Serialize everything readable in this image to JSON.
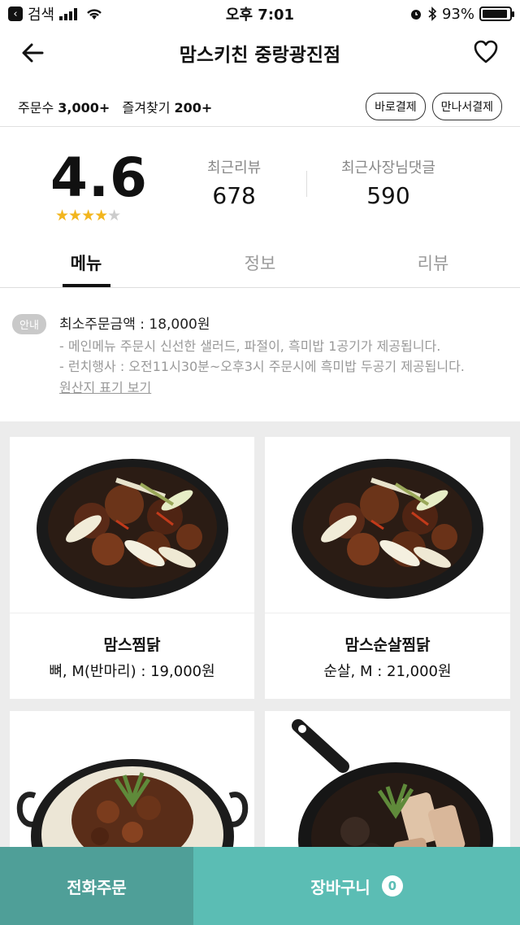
{
  "status_bar": {
    "back_app": "검색",
    "time": "오후 7:01",
    "battery_percent": "93%",
    "battery_level": 0.93
  },
  "header": {
    "title": "맘스키친 중랑광진점"
  },
  "order_info": {
    "orders_label": "주문수",
    "orders_value": "3,000+",
    "favorites_label": "즐겨찾기",
    "favorites_value": "200+",
    "pay_tags": [
      "바로결제",
      "만나서결제"
    ]
  },
  "rating": {
    "score": "4.6",
    "stars_value": 4.6,
    "recent_reviews_label": "최근리뷰",
    "recent_reviews_value": "678",
    "owner_replies_label": "최근사장님댓글",
    "owner_replies_value": "590"
  },
  "tabs": [
    {
      "label": "메뉴",
      "active": true
    },
    {
      "label": "정보",
      "active": false
    },
    {
      "label": "리뷰",
      "active": false
    }
  ],
  "notice": {
    "badge": "안내",
    "min_order": "최소주문금액 : 18,000원",
    "line1": "- 메인메뉴 주문시 신선한 샐러드, 파절이, 흑미밥 1공기가 제공됩니다.",
    "line2": "- 런치행사 : 오전11시30분~오후3시 주문시에 흑미밥 두공기 제공됩니다.",
    "origin_link": "원산지 표기 보기"
  },
  "menu": [
    {
      "name": "맘스찜닭",
      "price": "뼈, M(반마리) : 19,000원",
      "image": "braised-chicken-photo"
    },
    {
      "name": "맘스순살찜닭",
      "price": "순살, M : 21,000원",
      "image": "boneless-braised-chicken-photo"
    },
    {
      "name": "",
      "price": "",
      "image": "cheese-chicken-pan-photo"
    },
    {
      "name": "",
      "price": "",
      "image": "pork-skillet-photo"
    }
  ],
  "bottom_bar": {
    "phone_order": "전화주문",
    "cart": "장바구니",
    "cart_count": "0"
  },
  "colors": {
    "accent_dark": "#4f9f98",
    "accent": "#5bbdb4",
    "star": "#f2b51d"
  }
}
